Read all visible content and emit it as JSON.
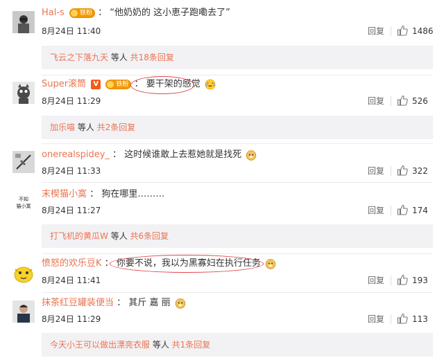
{
  "comments": [
    {
      "user": "Hal-s",
      "fan_badge": "铁粉",
      "colon": "：",
      "text": "“他奶奶的 这小恵子跑嘞去了”",
      "time": "8月24日 11:40",
      "reply": "回复",
      "likes": "1486",
      "sub": {
        "name": "飞云之下落九天",
        "mid": " 等人 ",
        "count": "共18条回复"
      }
    },
    {
      "user": "Super滚筒",
      "fan_badge": "铁粉",
      "colon": "：",
      "text": "要干架的感觉",
      "time": "8月24日 11:29",
      "reply": "回复",
      "likes": "526",
      "sub": {
        "name": "加乐喵",
        "mid": " 等人 ",
        "count": "共2条回复"
      }
    },
    {
      "user": "onerealspidey_",
      "colon": "：",
      "text": "这时候谁敢上去惹她就是找死",
      "time": "8月24日 11:33",
      "reply": "回复",
      "likes": "322"
    },
    {
      "user": "末楔猫小寞",
      "colon": "：",
      "text": "狗在哪里………",
      "time": "8月24日 11:27",
      "reply": "回复",
      "likes": "174",
      "sub": {
        "name": "打飞机的黄瓜W",
        "mid": " 等人 ",
        "count": "共6条回复"
      }
    },
    {
      "user": "愤怒的欢乐豆K",
      "colon": "：",
      "text": "你要不说，我以为黑寡妇在执行任务",
      "time": "8月24日 11:41",
      "reply": "回复",
      "likes": "193"
    },
    {
      "user": "抹茶红豆罐装便当",
      "colon": "：",
      "text": "其斤 嘉 丽",
      "time": "8月24日 11:29",
      "reply": "回复",
      "likes": "113",
      "sub": {
        "name": "今天小王可以做出漂亮衣服",
        "mid": " 等人 ",
        "count": "共1条回复"
      }
    }
  ],
  "avatar_4_text": "不知猫小寞",
  "colors": {
    "username": "#eb7350",
    "annotation": "#e0444a",
    "subbox": "#f2f2f5"
  }
}
